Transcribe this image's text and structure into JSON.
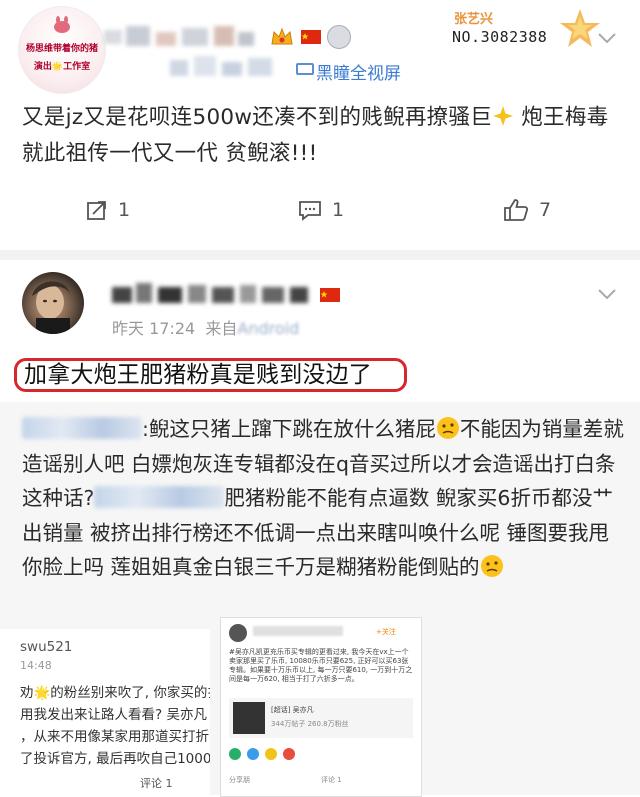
{
  "post1": {
    "avatar": {
      "line1": "杨思维带着你的猪",
      "line2": "演出🌟工作室"
    },
    "source": "黑瞳全视屏",
    "medal": {
      "name": "张艺兴",
      "number": "NO.3082388"
    },
    "text_a": "又是jz又是花呗连500w还凑不到的贱鲵再撩骚巨",
    "text_b": "炮王梅毒就此祖传一代又一代 贫鲵滚!!!",
    "actions": {
      "repost_count": "1",
      "comment_count": "1",
      "like_count": "7"
    }
  },
  "post2": {
    "time": "昨天 17:24",
    "via_prefix": "来自",
    "via_device": "Android",
    "highlight": "加拿大炮王肥猪粉真是贱到没边了",
    "repost_text": {
      "s1": ":鲵这只猪上蹿下跳在放什么猪屁",
      "s2": "不能因为销量差就造谣别人吧 白嫖炮灰连专辑都没在q音买过所以才会造谣出打白条这种话?",
      "s3": "肥猪粉能不能有点逼数 鲵家买6折币都没艹出销量 被挤出排行榜还不低调一点出来瞎叫唤什么呢 锤图要我甩你脸上吗 莲姐姐真金白银三千万是糊猪粉能倒贴的"
    },
    "embedded_left": {
      "user": "swu521",
      "time": "14:48",
      "line1": "劝🌟的粉丝别来吹了, 你家买的扌",
      "line2": "用我发出来让路人看看? 吴亦凡",
      "line3": "，从来不用像某家用那道买打折乡",
      "line4": "了投诉官方, 最后再吹自己1000v",
      "comment": "评论 1"
    },
    "embedded_right": {
      "header": "+关注",
      "body": "#吴亦凡凯更充乐币买专辑的更看过来, 我今天在vx上一个卖家那里买了乐币, 10080乐币只要625, 正好可以买63张专辑。如果要十万乐币以上, 每一万只要610, 一万到十万之间是每一万620, 相当于打了六折多一点。",
      "card_tag": "[超话] 吴亦凡",
      "card_sub": "344万帖子 260.8万粉丝",
      "footer": "分享朋",
      "footer2": "评论 1"
    }
  }
}
